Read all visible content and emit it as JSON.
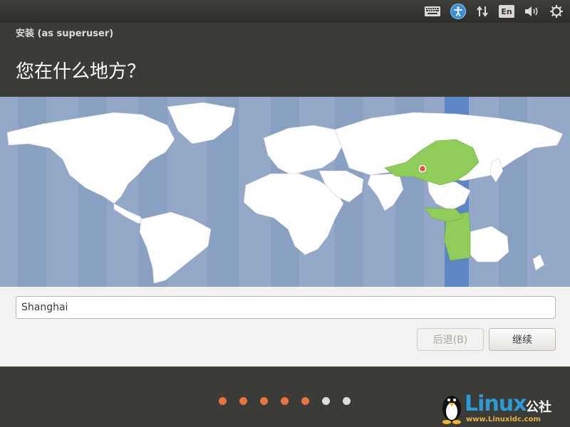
{
  "top_panel": {
    "icons": [
      "keyboard-icon",
      "accessibility-icon",
      "network-arrows-icon",
      "language-icon",
      "volume-icon",
      "gear-icon"
    ],
    "language_label": "En"
  },
  "window": {
    "title": "安装 (as superuser)",
    "heading": "您在什么地方？"
  },
  "location": {
    "value": "Shanghai"
  },
  "buttons": {
    "back_label": "后退(B)",
    "continue_label": "继续"
  },
  "progress": {
    "total_steps": 7,
    "completed_steps": 5,
    "done_color": "#e8733f",
    "todo_color": "#dedcd9"
  },
  "map": {
    "selected_timezone_region": "China",
    "highlight_color": "#8fcc5a",
    "ocean_color": "#93a8c8"
  },
  "watermark": {
    "brand": "Linux",
    "suffix": "公社",
    "url": "www.Linuxidc.com"
  }
}
